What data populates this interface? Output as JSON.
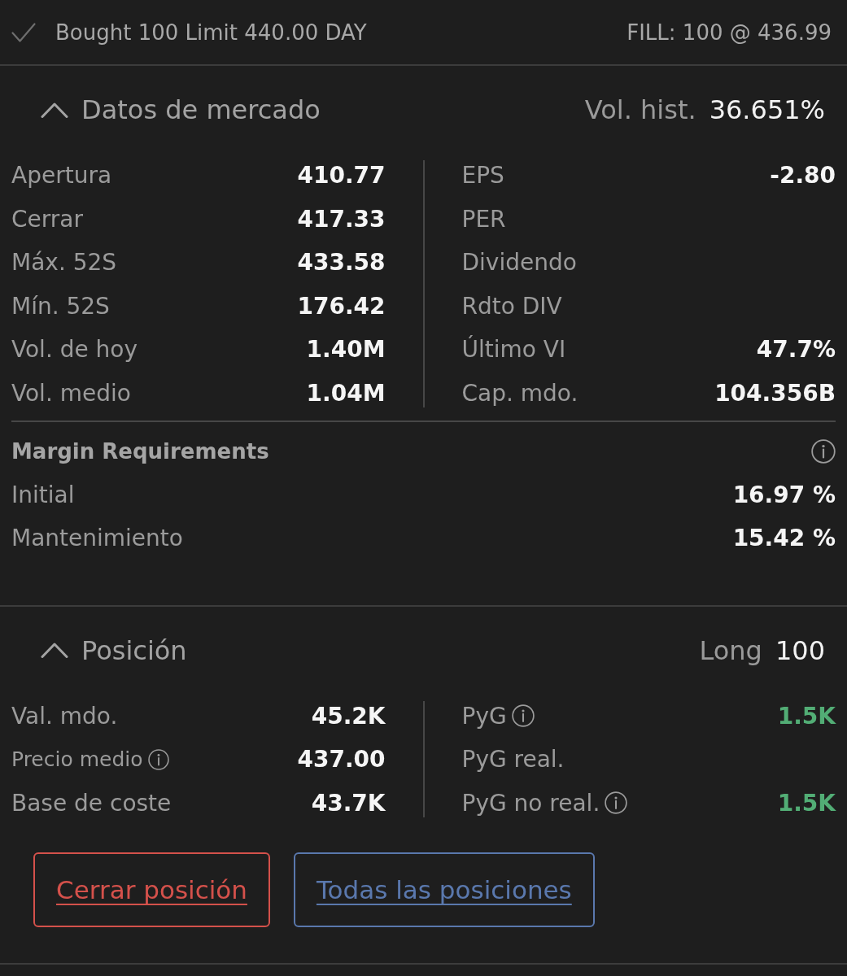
{
  "order": {
    "description": "Bought 100 Limit 440.00 DAY",
    "fill": "FILL: 100 @ 436.99"
  },
  "market_data": {
    "title": "Datos de mercado",
    "expanded": true,
    "stat_label": "Vol. hist.",
    "stat_value": "36.651%",
    "left": [
      {
        "label": "Apertura",
        "value": "410.77"
      },
      {
        "label": "Cerrar",
        "value": "417.33"
      },
      {
        "label": "Máx. 52S",
        "value": "433.58"
      },
      {
        "label": "Mín. 52S",
        "value": "176.42"
      },
      {
        "label": "Vol. de hoy",
        "value": "1.40M"
      },
      {
        "label": "Vol. medio",
        "value": "1.04M"
      }
    ],
    "right": [
      {
        "label": "EPS",
        "value": "-2.80"
      },
      {
        "label": "PER"
      },
      {
        "label": "Dividendo"
      },
      {
        "label": "Rdto DIV"
      },
      {
        "label": "Último VI",
        "value": "47.7%"
      },
      {
        "label": "Cap. mdo.",
        "value": "104.356B"
      }
    ]
  },
  "margin_requirements": {
    "title": "Margin Requirements",
    "rows": [
      {
        "label": "Initial",
        "value": "16.97 %"
      },
      {
        "label": "Mantenimiento",
        "value": "15.42 %"
      }
    ]
  },
  "position": {
    "title": "Posición",
    "expanded": true,
    "side": "Long",
    "quantity": "100",
    "left": [
      {
        "label": "Val. mdo.",
        "info": false,
        "value": "45.2K"
      },
      {
        "label": "Precio medio",
        "info": true,
        "value": "437.00"
      },
      {
        "label": "Base de coste",
        "info": false,
        "value": "43.7K"
      }
    ],
    "right": [
      {
        "label": "PyG",
        "info": true,
        "value": "1.5K",
        "color": "#52ad75"
      },
      {
        "label": "PyG real.",
        "info": false
      },
      {
        "label": "PyG no real.",
        "info": true,
        "value": "1.5K",
        "color": "#52ad75"
      }
    ]
  },
  "buttons": [
    {
      "label": "Cerrar posición",
      "kind": "danger"
    },
    {
      "label": "Todas las posiciones",
      "kind": "secondary"
    }
  ]
}
